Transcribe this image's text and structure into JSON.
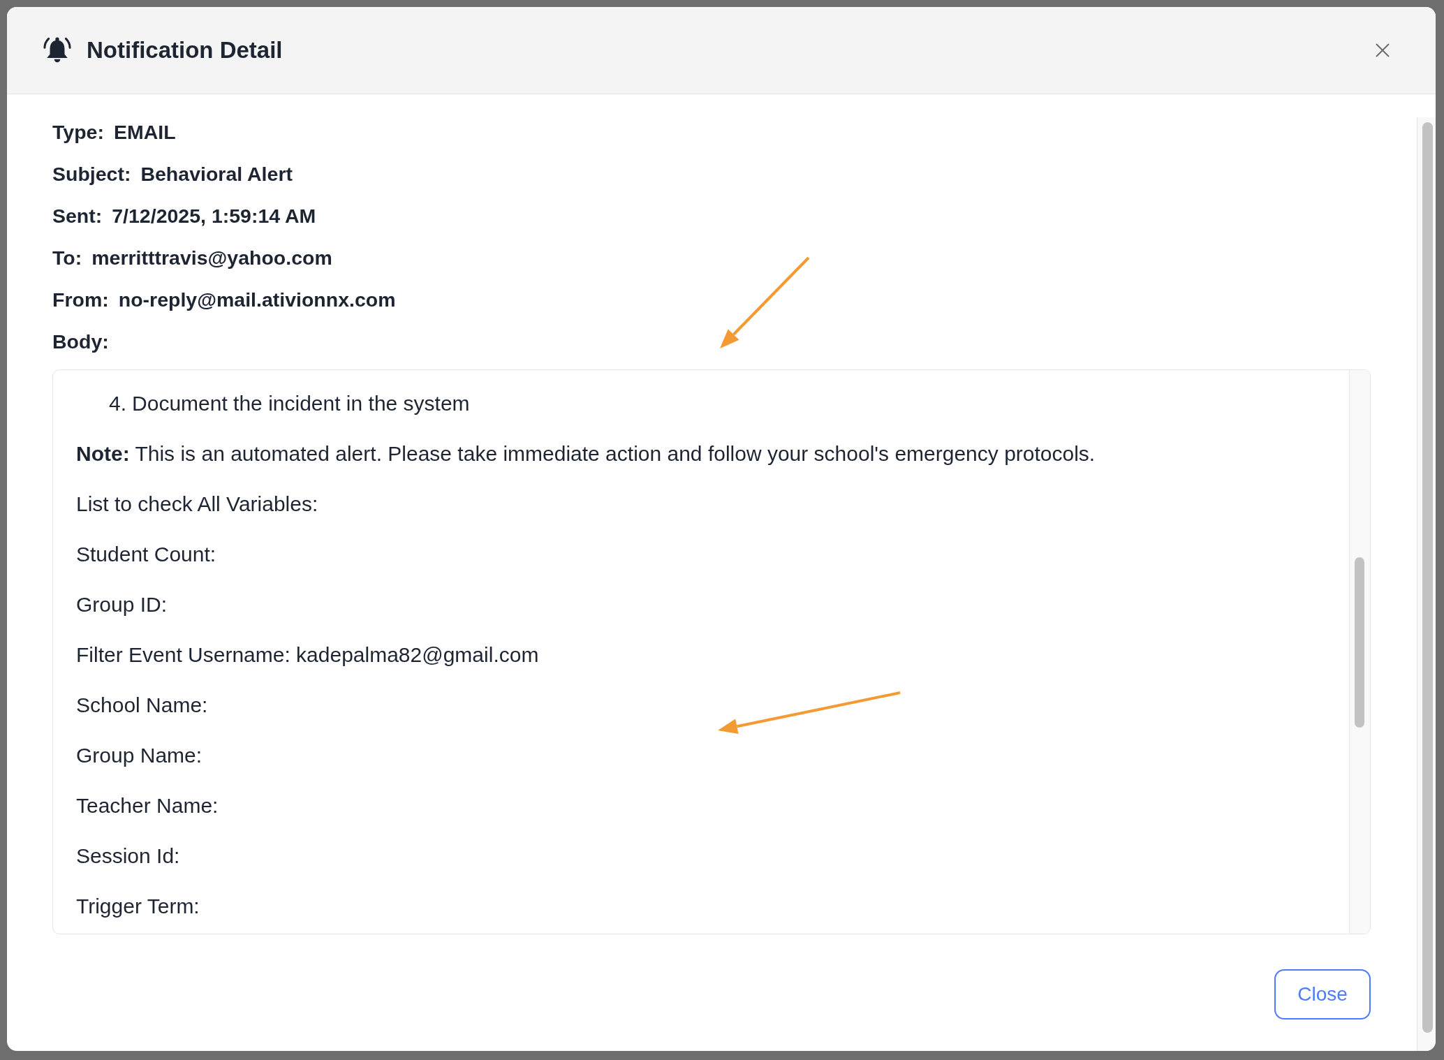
{
  "dialog": {
    "title": "Notification Detail"
  },
  "details": [
    {
      "label": "Type:",
      "value": "EMAIL"
    },
    {
      "label": "Subject:",
      "value": "Behavioral Alert"
    },
    {
      "label": "Sent:",
      "value": "7/12/2025, 1:59:14 AM"
    },
    {
      "label": "To:",
      "value": "merritttravis@yahoo.com"
    },
    {
      "label": "From:",
      "value": "no-reply@mail.ativionnx.com"
    }
  ],
  "body": {
    "label": "Body:",
    "lines": [
      {
        "kind": "list_item",
        "number": "4.",
        "text": "Document the incident in the system"
      },
      {
        "kind": "paragraph",
        "text": "**Note:** This is an automated alert. Please take immediate action and follow your school's emergency protocols."
      },
      {
        "kind": "paragraph",
        "text": "List to check All Variables:"
      },
      {
        "kind": "paragraph",
        "text": "Student Count:"
      },
      {
        "kind": "paragraph",
        "text": "Group ID:"
      },
      {
        "kind": "paragraph",
        "text": "Filter Event Username: kadepalma82@gmail.com"
      },
      {
        "kind": "paragraph",
        "text": "School Name:"
      },
      {
        "kind": "paragraph",
        "text": "Group Name:"
      },
      {
        "kind": "paragraph",
        "text": "Teacher Name:"
      },
      {
        "kind": "paragraph",
        "text": "Session Id:"
      },
      {
        "kind": "paragraph",
        "text": "Trigger Term:"
      }
    ]
  },
  "buttons": [
    {
      "label": "Close"
    }
  ],
  "annotations": [
    {
      "kind": "arrow"
    },
    {
      "kind": "arrow"
    }
  ]
}
